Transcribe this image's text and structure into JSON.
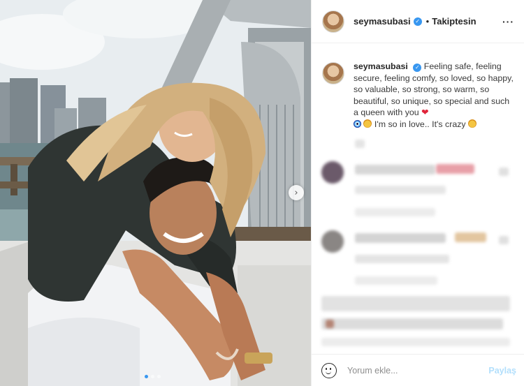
{
  "post": {
    "username": "seymasubasi",
    "follow_status": "Takiptesin",
    "separator": "•",
    "more_icon": "more-dots-icon",
    "next_icon": "chevron-right-icon",
    "carousel": {
      "count": 3,
      "active": 0
    }
  },
  "caption": {
    "username": "seymasubasi",
    "text_part1": "Feeling safe, feeling secure, feeling comfy, so loved, so happy, so valuable, so strong, so warm, so beautiful, so unique, so special and such a queen with you ",
    "text_part2": " I'm so in love.. It's crazy "
  },
  "comment_box": {
    "placeholder": "Yorum ekle...",
    "share_label": "Paylaş"
  },
  "colors": {
    "accent": "#3897f0",
    "share_disabled": "#b2dffc",
    "heart": "#e0243a"
  }
}
